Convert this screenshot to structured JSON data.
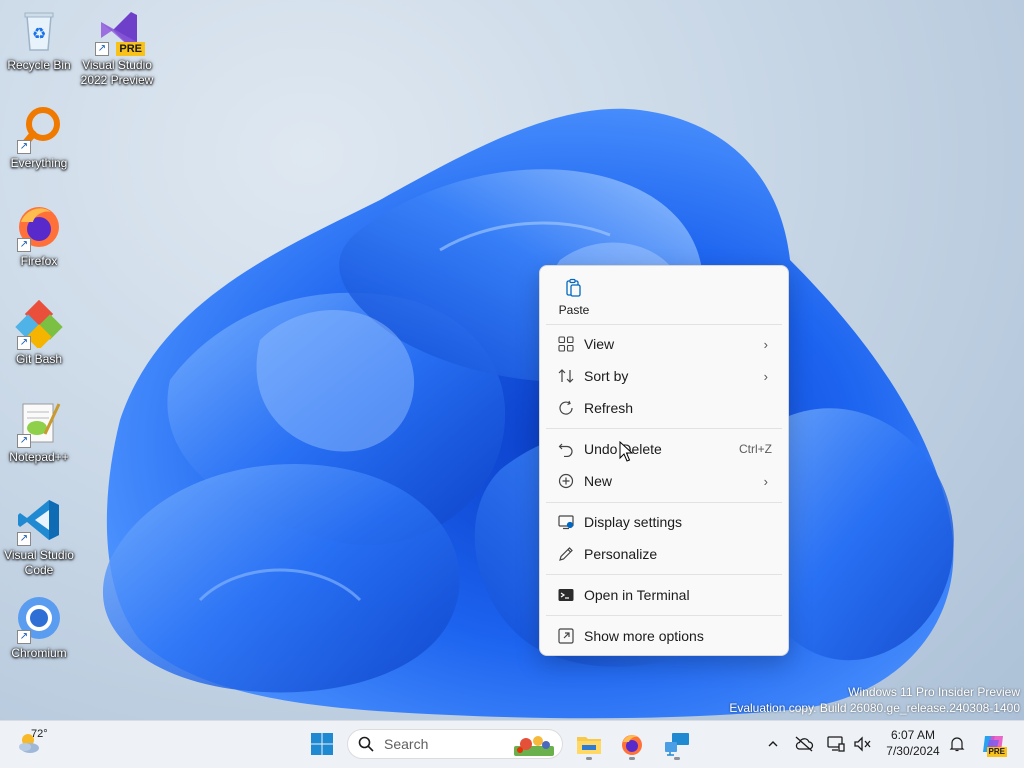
{
  "desktop_icons": [
    {
      "label": "Recycle Bin",
      "icon": "recycle-bin-icon"
    },
    {
      "label": "Visual Studio 2022 Preview",
      "icon": "visual-studio-icon",
      "badge": "PRE"
    },
    {
      "label": "Everything",
      "icon": "everything-search-icon"
    },
    {
      "label": "Firefox",
      "icon": "firefox-icon"
    },
    {
      "label": "Git Bash",
      "icon": "git-bash-icon"
    },
    {
      "label": "Notepad++",
      "icon": "notepad-plus-plus-icon"
    },
    {
      "label": "Visual Studio Code",
      "icon": "vscode-icon"
    },
    {
      "label": "Chromium",
      "icon": "chromium-icon"
    }
  ],
  "context_menu": {
    "paste": {
      "label": "Paste",
      "icon": "paste-icon"
    },
    "items": [
      {
        "label": "View",
        "icon": "grid-view-icon",
        "submenu": true
      },
      {
        "label": "Sort by",
        "icon": "sort-icon",
        "submenu": true
      },
      {
        "label": "Refresh",
        "icon": "refresh-icon"
      },
      {
        "label": "Undo Delete",
        "icon": "undo-icon",
        "shortcut": "Ctrl+Z"
      },
      {
        "label": "New",
        "icon": "new-plus-icon",
        "submenu": true
      },
      {
        "label": "Display settings",
        "icon": "display-settings-icon"
      },
      {
        "label": "Personalize",
        "icon": "pen-icon"
      },
      {
        "label": "Open in Terminal",
        "icon": "terminal-icon"
      },
      {
        "label": "Show more options",
        "icon": "more-options-icon"
      }
    ]
  },
  "watermark": {
    "line1": "Windows 11 Pro Insider Preview",
    "line2": "Evaluation copy. Build 26080.ge_release.240308-1400"
  },
  "taskbar": {
    "weather_temp": "72°",
    "search_placeholder": "Search",
    "clock_time": "6:07 AM",
    "clock_date": "7/30/2024",
    "pinned": [
      "start-icon",
      "file-explorer-icon",
      "firefox-icon",
      "remote-desktop-icon"
    ],
    "copilot_badge": "PRE"
  },
  "colors": {
    "accent": "#0067c0",
    "bloom": "#1a5fe0",
    "menu_bg": "#f9f9f9",
    "taskbar_bg": "#eef1f6"
  }
}
